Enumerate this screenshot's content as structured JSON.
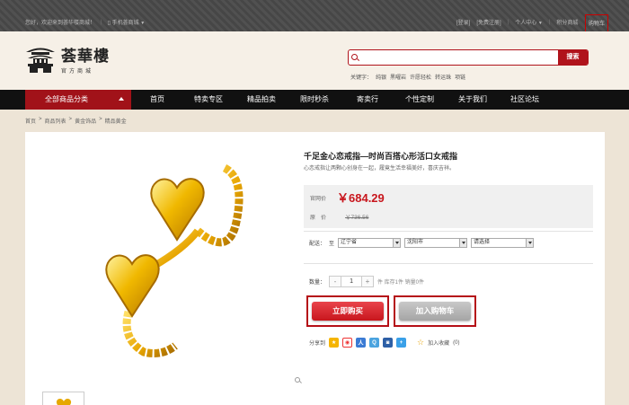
{
  "topbar": {
    "welcome": "您好，欢迎来到荟华楼商城！",
    "mobile": "手机荟商城",
    "login": "[登录]",
    "register": "[免费注册]",
    "user_center": "个人中心",
    "points_mall": "积分商城",
    "cart": "购物车"
  },
  "logo": {
    "name": "荟華樓",
    "sub": "官方商城"
  },
  "search": {
    "placeholder": "",
    "button": "搜索",
    "keywords_label": "关键字：",
    "keywords": [
      "纯银",
      "黑曜岩",
      "许愿轻松",
      "转运珠",
      "项链"
    ]
  },
  "nav": {
    "all_categories": "全部商品分类",
    "items": [
      "首页",
      "特卖专区",
      "精品拍卖",
      "限时秒杀",
      "寄卖行",
      "个性定制",
      "关于我们",
      "社区论坛"
    ]
  },
  "breadcrumb": [
    "首页",
    ">",
    "商品列表",
    ">",
    "黄金饰品",
    ">",
    "精品黄金"
  ],
  "product": {
    "title": "千足金心恋戒指—时尚百搭心形活口女戒指",
    "subtitle": "心恋戒指让两颗心创身在一起，履竟生活幸福美好，喜庆吉祥。",
    "price_label": "官网价",
    "price": "￥684.29",
    "orig_label": "原　价",
    "orig_price": "￥736.56",
    "ship_label": "配送：",
    "ship_to": "至",
    "province": "辽宁省",
    "city": "沈阳市",
    "district": "请选择",
    "qty_label": "数量：",
    "qty_minus": "-",
    "qty_value": "1",
    "qty_plus": "+",
    "stock": "件 库存1件 销量0件",
    "buy_now": "立即购买",
    "add_to_cart": "加入购物车",
    "share_label": "分享到",
    "favorite": "加入收藏",
    "favorite_count": "(0)"
  },
  "colors": {
    "brand_red": "#b0131b",
    "price_red": "#c8161d",
    "nav_bg": "#111111",
    "gold": "#e0a800"
  }
}
